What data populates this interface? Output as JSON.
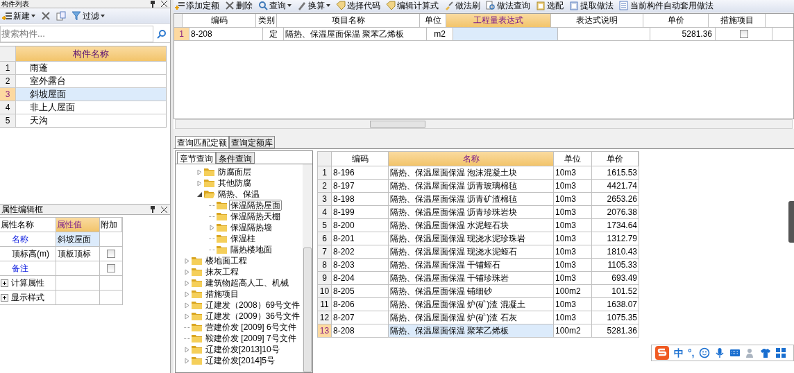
{
  "component_panel": {
    "title": "构件列表",
    "toolbar": [
      {
        "kind": "new",
        "label": "新建"
      },
      {
        "kind": "delete"
      },
      {
        "kind": "copy"
      },
      {
        "kind": "filter",
        "label": "过滤"
      }
    ],
    "search": {
      "placeholder": "搜索构件..."
    },
    "column": "构件名称",
    "rows": [
      {
        "num": "1",
        "name": "雨蓬",
        "selected": false
      },
      {
        "num": "2",
        "name": "室外露台",
        "selected": false
      },
      {
        "num": "3",
        "name": "斜坡屋面",
        "selected": true
      },
      {
        "num": "4",
        "name": "非上人屋面",
        "selected": false
      },
      {
        "num": "5",
        "name": "天沟",
        "selected": false
      }
    ]
  },
  "property_panel": {
    "title": "属性编辑框",
    "columns": [
      "属性名称",
      "属性值",
      "附加"
    ],
    "rows": [
      {
        "name": "名称",
        "value": "斜坡屋面",
        "highlight": true,
        "checkbox": false,
        "group": false
      },
      {
        "name": "顶标高(m)",
        "value": "顶板顶标",
        "highlight": false,
        "checkbox": true,
        "checked": false,
        "group": false
      },
      {
        "name": "备注",
        "highlight": true,
        "checkbox": true,
        "checked": false,
        "group": false
      },
      {
        "name": "计算属性",
        "highlight": false,
        "checkbox": false,
        "group": true
      },
      {
        "name": "显示样式",
        "highlight": false,
        "checkbox": false,
        "group": true
      }
    ]
  },
  "top_toolbar": [
    {
      "kind": "add",
      "label": "添加定额"
    },
    {
      "kind": "delete",
      "label": "删除"
    },
    {
      "kind": "search",
      "label": "查询",
      "menu": true
    },
    {
      "kind": "convert",
      "label": "换算",
      "menu": true
    },
    {
      "kind": "code",
      "label": "选择代码"
    },
    {
      "kind": "formula",
      "label": "编辑计算式"
    },
    {
      "kind": "brush",
      "label": "做法刷"
    },
    {
      "kind": "query",
      "label": "做法查询"
    },
    {
      "kind": "match",
      "label": "选配"
    },
    {
      "kind": "extract",
      "label": "提取做法"
    },
    {
      "kind": "auto",
      "label": "当前构件自动套用做法"
    }
  ],
  "quota_table": {
    "columns": [
      "编码",
      "类别",
      "项目名称",
      "单位",
      "工程量表达式",
      "表达式说明",
      "单价",
      "措施项目"
    ],
    "rows": [
      {
        "num": "1",
        "code": "8-208",
        "category": "定",
        "name": "隔热、保温屋面保温 聚苯乙烯板",
        "unit": "m2",
        "price": "5281.36",
        "measure": false
      }
    ]
  },
  "bottom_tabs": [
    {
      "label": "查询匹配定额",
      "selected": true
    },
    {
      "label": "查询定额库",
      "selected": false
    }
  ],
  "inner_tabs": [
    {
      "label": "章节查询",
      "selected": true
    },
    {
      "label": "条件查询",
      "selected": false
    }
  ],
  "tree": {
    "nested_items": [
      {
        "label": "防腐面层",
        "expanded": false,
        "selected": false
      },
      {
        "label": "其他防腐",
        "expanded": false,
        "selected": false
      },
      {
        "label": "隔热、保温",
        "expanded": true,
        "selected": false,
        "children": [
          {
            "label": "保温隔热屋面",
            "selected": true
          },
          {
            "label": "保温隔热天棚",
            "selected": false
          },
          {
            "label": "保温隔热墙",
            "expanded": false,
            "selected": false
          },
          {
            "label": "保温柱",
            "selected": false
          },
          {
            "label": "隔热楼地面",
            "selected": false
          }
        ]
      }
    ],
    "items": [
      {
        "label": "楼地面工程",
        "expanded": false,
        "selected": false
      },
      {
        "label": "抹灰工程",
        "expanded": false,
        "selected": false
      },
      {
        "label": "建筑物超高人工、机械",
        "expanded": false,
        "selected": false
      },
      {
        "label": "措施项目",
        "expanded": false,
        "selected": false
      },
      {
        "label": "辽建发（2008）69号文件",
        "expanded": false,
        "selected": false
      },
      {
        "label": "辽建发（2009）36号文件",
        "expanded": false,
        "selected": false
      },
      {
        "label": "营建价发 [2009] 6号文件",
        "selected": false
      },
      {
        "label": "鞍建价发 [2009] 7号文件",
        "selected": false
      },
      {
        "label": "辽建价发[2013]10号",
        "expanded": false,
        "selected": false
      },
      {
        "label": "辽建价发[2014]5号",
        "expanded": false,
        "selected": false
      }
    ]
  },
  "match_table": {
    "columns": [
      "编码",
      "名称",
      "单位",
      "单价"
    ],
    "rows": [
      {
        "num": "1",
        "code": "8-196",
        "name": "隔热、保温屋面保温 泡沫混凝土块",
        "unit": "10m3",
        "price": "1615.53",
        "selected": false
      },
      {
        "num": "2",
        "code": "8-197",
        "name": "隔热、保温屋面保温 沥青玻璃棉毡",
        "unit": "10m3",
        "price": "4421.74",
        "selected": false
      },
      {
        "num": "3",
        "code": "8-198",
        "name": "隔热、保温屋面保温 沥青矿渣棉毡",
        "unit": "10m3",
        "price": "2653.26",
        "selected": false
      },
      {
        "num": "4",
        "code": "8-199",
        "name": "隔热、保温屋面保温 沥青珍珠岩块",
        "unit": "10m3",
        "price": "2076.38",
        "selected": false
      },
      {
        "num": "5",
        "code": "8-200",
        "name": "隔热、保温屋面保温 水泥蛭石块",
        "unit": "10m3",
        "price": "1734.64",
        "selected": false
      },
      {
        "num": "6",
        "code": "8-201",
        "name": "隔热、保温屋面保温 现浇水泥珍珠岩",
        "unit": "10m3",
        "price": "1312.79",
        "selected": false
      },
      {
        "num": "7",
        "code": "8-202",
        "name": "隔热、保温屋面保温 现浇水泥蛭石",
        "unit": "10m3",
        "price": "1810.43",
        "selected": false
      },
      {
        "num": "8",
        "code": "8-203",
        "name": "隔热、保温屋面保温 干铺蛭石",
        "unit": "10m3",
        "price": "1105.33",
        "selected": false
      },
      {
        "num": "9",
        "code": "8-204",
        "name": "隔热、保温屋面保温 干铺珍珠岩",
        "unit": "10m3",
        "price": "693.49",
        "selected": false
      },
      {
        "num": "10",
        "code": "8-205",
        "name": "隔热、保温屋面保温 铺细砂",
        "unit": "100m2",
        "price": "101.52",
        "selected": false
      },
      {
        "num": "11",
        "code": "8-206",
        "name": "隔热、保温屋面保温 炉(矿)渣 混凝土",
        "unit": "10m3",
        "price": "1638.07",
        "selected": false
      },
      {
        "num": "12",
        "code": "8-207",
        "name": "隔热、保温屋面保温 炉(矿)渣 石灰",
        "unit": "10m3",
        "price": "1075.35",
        "selected": false
      },
      {
        "num": "13",
        "code": "8-208",
        "name": "隔热、保温屋面保温 聚苯乙烯板",
        "unit": "100m2",
        "price": "5281.36",
        "selected": true
      }
    ]
  },
  "ime_toolbar": {
    "items": [
      {
        "kind": "text",
        "label": "中"
      },
      {
        "kind": "text",
        "label": "°,"
      },
      {
        "kind": "emoji"
      },
      {
        "kind": "mic"
      },
      {
        "kind": "keyboard"
      },
      {
        "kind": "user"
      },
      {
        "kind": "shirt"
      },
      {
        "kind": "grid"
      }
    ]
  }
}
